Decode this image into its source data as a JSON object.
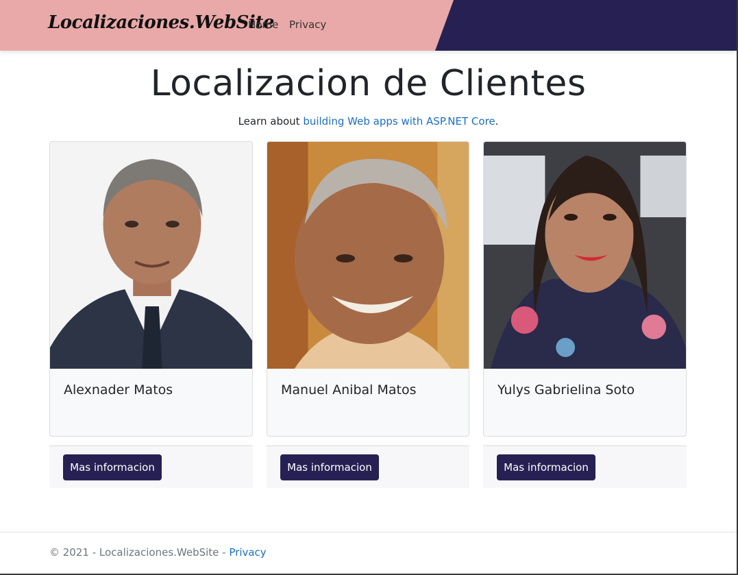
{
  "navbar": {
    "brand": "Localizaciones.WebSite",
    "links": [
      "Home",
      "Privacy"
    ],
    "colors": {
      "pink": "#e9a9a8",
      "navy": "#262152"
    }
  },
  "main": {
    "title": "Localizacion de Clientes",
    "lead_prefix": "Learn about ",
    "lead_link": "building Web apps with ASP.NET Core",
    "lead_suffix": "."
  },
  "cards": [
    {
      "name": "Alexnader Matos",
      "button": "Mas informacion"
    },
    {
      "name": "Manuel Anibal Matos",
      "button": "Mas informacion"
    },
    {
      "name": "Yulys Gabrielina Soto",
      "button": "Mas informacion"
    }
  ],
  "footer": {
    "text": "© 2021 - Localizaciones.WebSite - ",
    "link": "Privacy"
  }
}
